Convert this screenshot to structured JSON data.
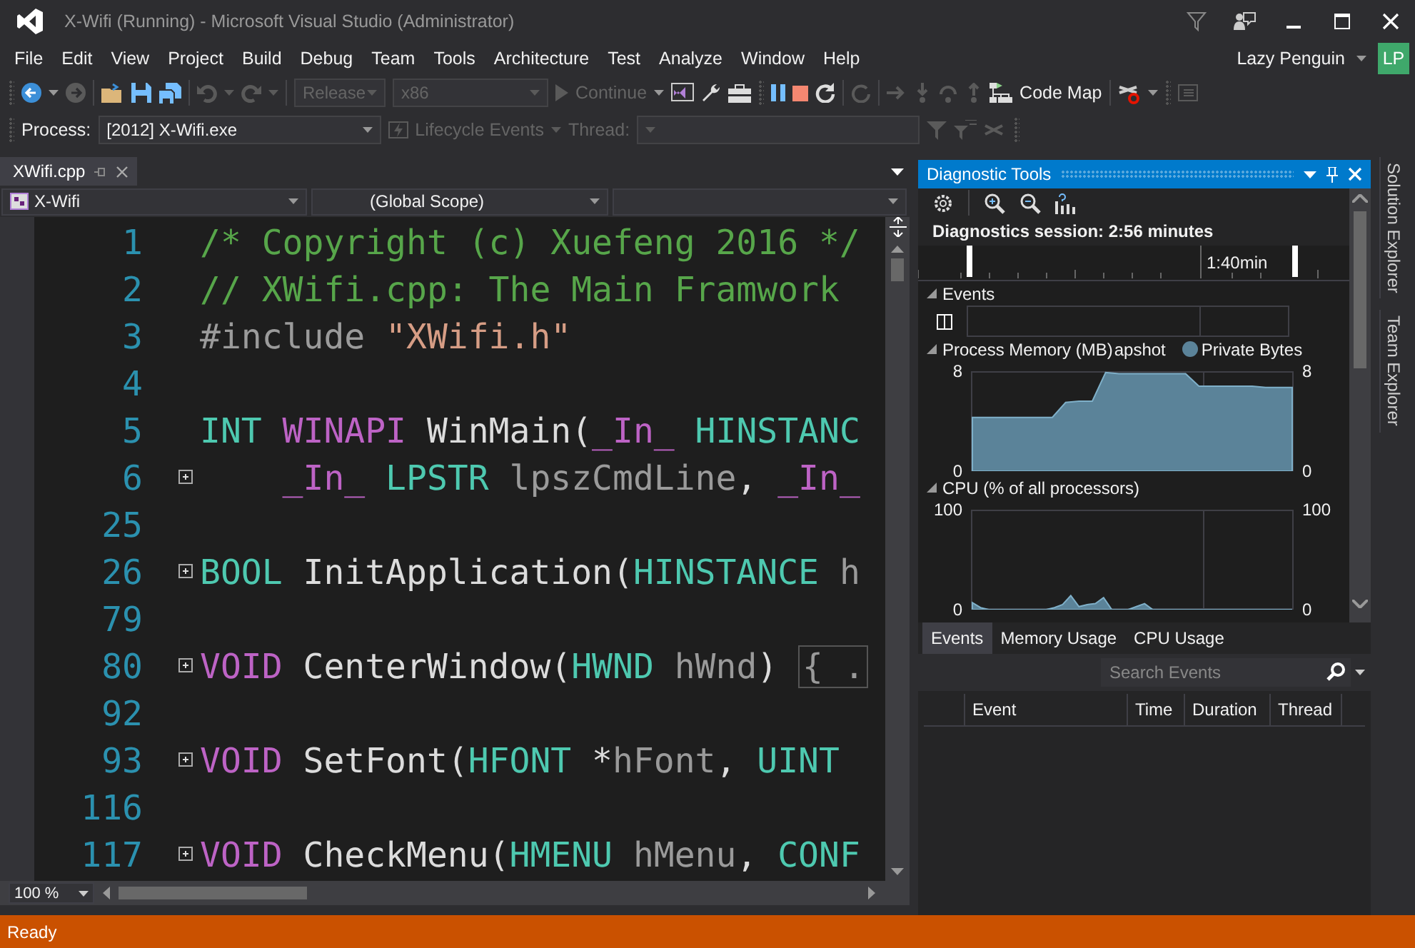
{
  "window": {
    "title": "X-Wifi (Running) - Microsoft Visual Studio (Administrator)"
  },
  "menu": [
    "File",
    "Edit",
    "View",
    "Project",
    "Build",
    "Debug",
    "Team",
    "Tools",
    "Architecture",
    "Test",
    "Analyze",
    "Window",
    "Help"
  ],
  "user": {
    "name": "Lazy Penguin",
    "initials": "LP",
    "color": "#3fa86b"
  },
  "toolbar": {
    "configuration": {
      "value": "Release",
      "disabled": true
    },
    "platform": {
      "value": "x86",
      "disabled": true
    },
    "continue": {
      "label": "Continue",
      "disabled": true
    },
    "code_map": {
      "label": "Code Map",
      "disabled": false
    }
  },
  "debug_bar": {
    "process_label": "Process:",
    "process": "[2012] X-Wifi.exe",
    "lifecycle": {
      "label": "Lifecycle Events",
      "disabled": true
    },
    "thread_label": "Thread:"
  },
  "editor": {
    "tabs": [
      {
        "label": "XWifi.cpp",
        "selected": true
      }
    ],
    "navigation": [
      "X-Wifi",
      "(Global Scope)"
    ],
    "zoom": "100 %",
    "lines": [
      {
        "number": "1",
        "collapsed": false,
        "tokens": [
          {
            "kind": "comment",
            "text": "/* Copyright (c) Xuefeng 2016 */"
          }
        ]
      },
      {
        "number": "2",
        "collapsed": false,
        "tokens": [
          {
            "kind": "comment",
            "text": "// XWifi.cpp: The Main Framwork"
          }
        ]
      },
      {
        "number": "3",
        "collapsed": false,
        "tokens": [
          {
            "kind": "preproc",
            "text": "#include "
          },
          {
            "kind": "string",
            "text": "\"XWifi.h\""
          }
        ]
      },
      {
        "number": "4",
        "collapsed": false
      },
      {
        "number": "5",
        "collapsed": false,
        "tokens": [
          {
            "kind": "type",
            "text": "INT "
          },
          {
            "kind": "macro",
            "text": "WINAPI "
          },
          {
            "kind": "plain",
            "text": "WinMain("
          },
          {
            "kind": "macro",
            "text": "_In_ "
          },
          {
            "kind": "type",
            "text": "HINSTANC"
          }
        ]
      },
      {
        "number": "6",
        "collapsed": true,
        "tokens": [
          {
            "kind": "macro",
            "text": "    _In_ "
          },
          {
            "kind": "type",
            "text": "LPSTR "
          },
          {
            "kind": "param",
            "text": "lpszCmdLine"
          },
          {
            "kind": "plain",
            "text": ", "
          },
          {
            "kind": "macro",
            "text": "_In_"
          }
        ]
      },
      {
        "number": "25",
        "collapsed": false
      },
      {
        "number": "26",
        "collapsed": true,
        "tokens": [
          {
            "kind": "type",
            "text": "BOOL "
          },
          {
            "kind": "plain",
            "text": "InitApplication("
          },
          {
            "kind": "type",
            "text": "HINSTANCE "
          },
          {
            "kind": "param",
            "text": "h"
          }
        ]
      },
      {
        "number": "79",
        "collapsed": false
      },
      {
        "number": "80",
        "collapsed": true,
        "tokens": [
          {
            "kind": "macro",
            "text": "VOID "
          },
          {
            "kind": "plain",
            "text": "CenterWindow("
          },
          {
            "kind": "type",
            "text": "HWND "
          },
          {
            "kind": "param",
            "text": "hWnd"
          },
          {
            "kind": "plain",
            "text": ") "
          },
          {
            "kind": "folded",
            "text": "{ ."
          }
        ]
      },
      {
        "number": "92",
        "collapsed": false
      },
      {
        "number": "93",
        "collapsed": true,
        "tokens": [
          {
            "kind": "macro",
            "text": "VOID "
          },
          {
            "kind": "plain",
            "text": "SetFont("
          },
          {
            "kind": "type",
            "text": "HFONT "
          },
          {
            "kind": "plain",
            "text": "*"
          },
          {
            "kind": "param",
            "text": "hFont"
          },
          {
            "kind": "plain",
            "text": ", "
          },
          {
            "kind": "type",
            "text": "UINT"
          }
        ]
      },
      {
        "number": "116",
        "collapsed": false
      },
      {
        "number": "117",
        "collapsed": true,
        "tokens": [
          {
            "kind": "macro",
            "text": "VOID "
          },
          {
            "kind": "plain",
            "text": "CheckMenu("
          },
          {
            "kind": "type",
            "text": "HMENU "
          },
          {
            "kind": "param",
            "text": "hMenu"
          },
          {
            "kind": "plain",
            "text": ", "
          },
          {
            "kind": "type",
            "text": "CONF"
          }
        ]
      }
    ]
  },
  "diagnostics": {
    "title": "Diagnostic Tools",
    "session": "Diagnostics session: 2:56 minutes",
    "ruler_label": "1:40min",
    "events": {
      "title": "Events"
    },
    "memory": {
      "title": "Process Memory (MB)",
      "overlap_text": "apshot",
      "right_axis": [
        "8",
        "0"
      ],
      "chart_data": {
        "type": "area",
        "ylim": [
          0,
          8
        ],
        "yticks": [
          0,
          8
        ],
        "series": [
          {
            "name": "Private Bytes",
            "color": "#5b8399",
            "values": [
              4.3,
              4.3,
              4.3,
              4.3,
              4.3,
              4.3,
              4.3,
              5.5,
              5.6,
              5.6,
              7.9,
              7.8,
              7.8,
              7.8,
              7.8,
              7.8,
              7.8,
              6.8,
              6.8,
              6.8,
              6.8,
              6.8,
              6.7,
              6.7,
              6.7
            ]
          }
        ]
      }
    },
    "cpu": {
      "title": "CPU (% of all processors)",
      "right_axis": [
        "100",
        "0"
      ],
      "chart_data": {
        "type": "area",
        "ylim": [
          0,
          100
        ],
        "yticks": [
          0,
          100
        ],
        "series": [
          {
            "color": "#5b8399",
            "values": [
              7,
              2,
              0,
              0,
              0,
              0,
              0,
              0,
              0,
              0,
              2,
              5,
              14,
              3,
              5,
              6,
              12,
              0,
              0,
              0,
              3,
              6,
              0,
              0,
              0,
              0,
              0,
              0,
              0,
              0,
              0,
              0,
              0,
              0,
              0,
              0,
              0,
              0,
              0,
              0
            ]
          }
        ]
      }
    },
    "tabs": [
      {
        "label": "Events",
        "selected": true
      },
      {
        "label": "Memory Usage",
        "selected": false
      },
      {
        "label": "CPU Usage",
        "selected": false
      }
    ],
    "search": {
      "placeholder": "Search Events"
    },
    "columns": [
      "Event",
      "Time",
      "Duration",
      "Thread"
    ]
  },
  "side_tabs": [
    "Solution Explorer",
    "Team Explorer"
  ],
  "status_bar": {
    "text": "Ready"
  }
}
